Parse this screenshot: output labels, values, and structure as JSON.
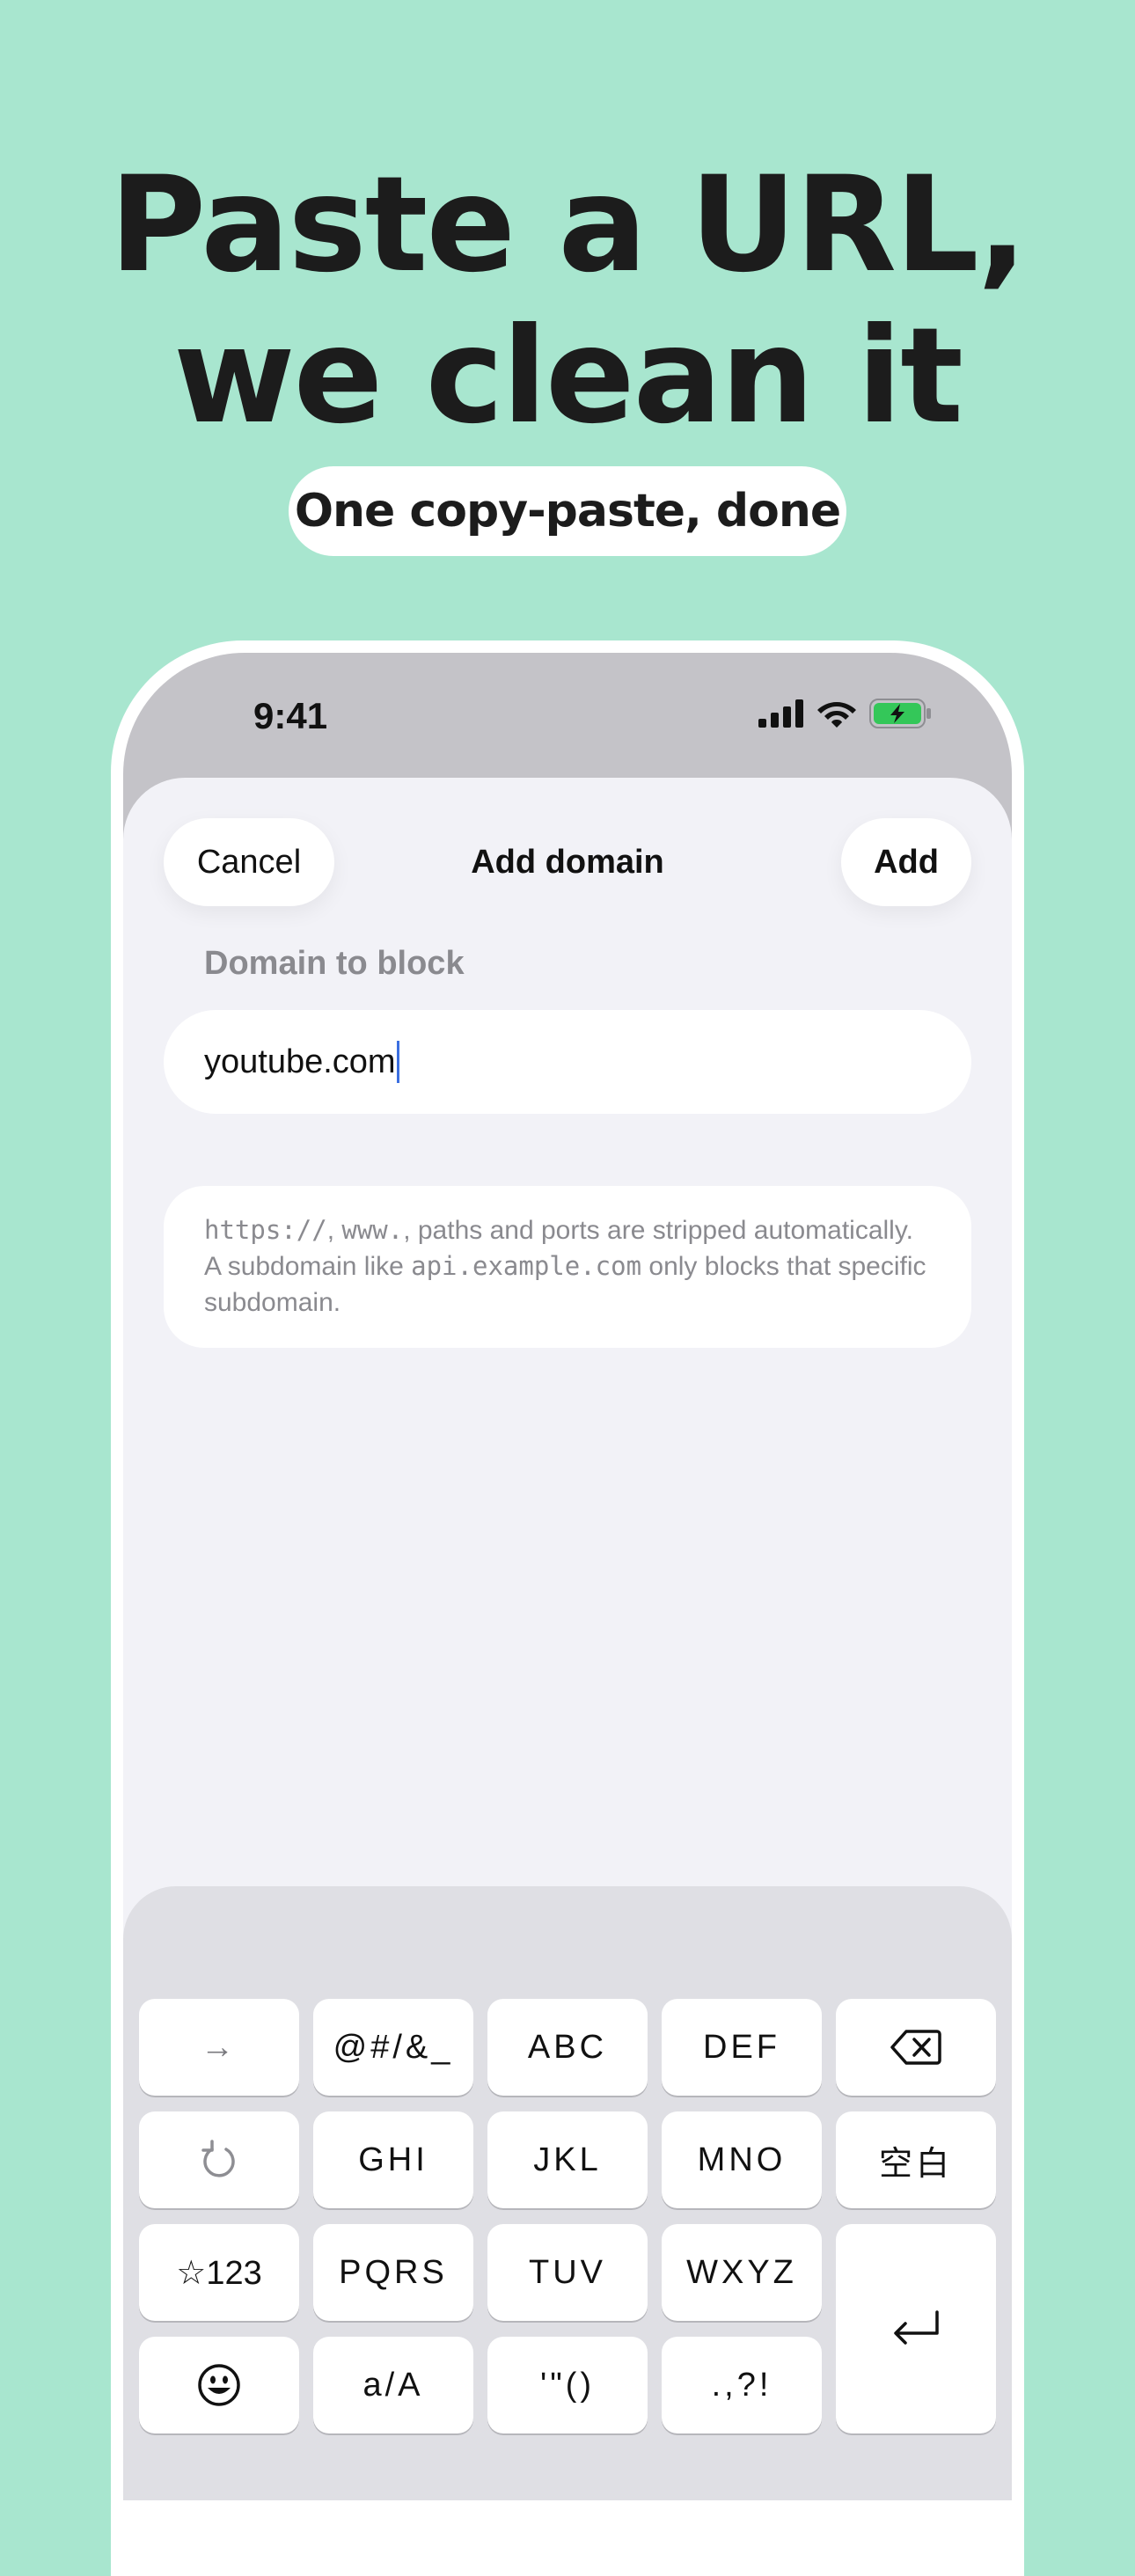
{
  "headline": {
    "line1": "Paste a URL,",
    "line2": "we clean it"
  },
  "subtitle": "One copy-paste, done",
  "status_bar": {
    "time": "9:41"
  },
  "sheet": {
    "cancel_label": "Cancel",
    "title": "Add domain",
    "add_label": "Add",
    "field_label": "Domain to block",
    "field_value": "youtube.com",
    "info": {
      "code1": "https://",
      "sep1": ", ",
      "code2": "www.",
      "text1": ", paths and ports are stripped automatically. A subdomain like ",
      "code3": "api.example.com",
      "text2": " only blocks that specific subdomain."
    }
  },
  "keyboard": {
    "row1": [
      "→",
      "@#/&_",
      "ABC",
      "DEF"
    ],
    "row2": [
      "GHI",
      "JKL",
      "MNO",
      "空白"
    ],
    "row3": [
      "☆123",
      "PQRS",
      "TUV",
      "WXYZ"
    ],
    "row4": [
      "a/A",
      "'\"()",
      ".,?!"
    ],
    "icons": [
      "delete-icon",
      "undo-icon",
      "emoji-icon",
      "return-icon"
    ]
  },
  "colors": {
    "background": "#a8e6cf",
    "accent": "#3b6fe0",
    "battery": "#34c759"
  }
}
